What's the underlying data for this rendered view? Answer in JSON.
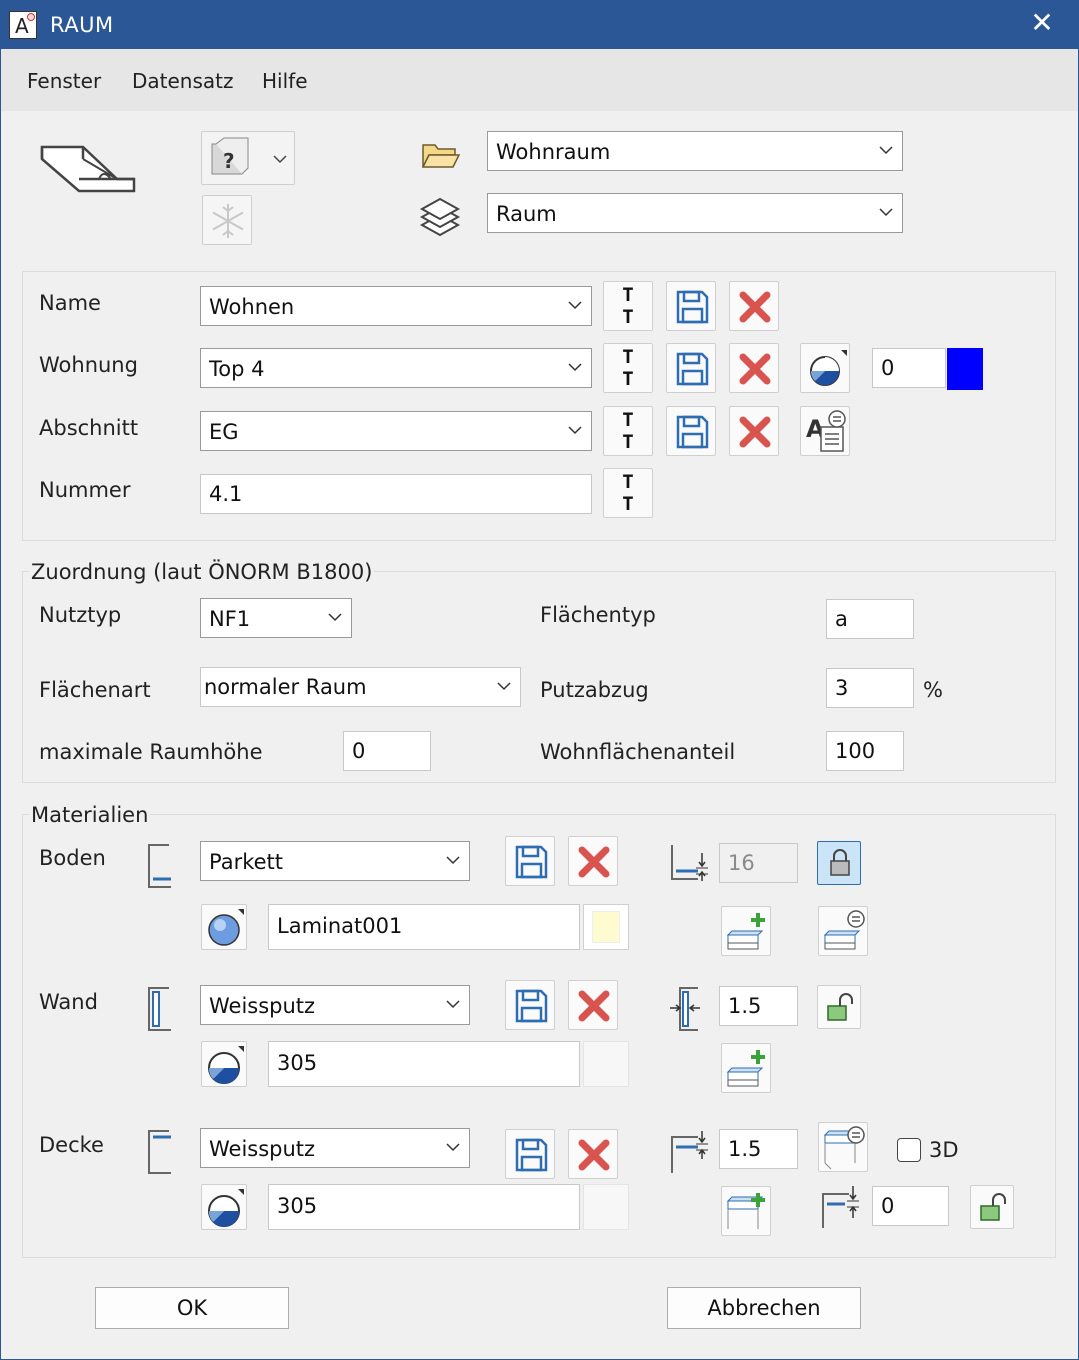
{
  "window": {
    "title": "RAUM",
    "close_symbol": "✕"
  },
  "menu": [
    "Fenster",
    "Datensatz",
    "Hilfe"
  ],
  "top": {
    "folder_combo": "Wohnraum",
    "layer_combo": "Raum",
    "help_glyph": "?"
  },
  "ident": {
    "name_label": "Name",
    "name_value": "Wohnen",
    "wohnung_label": "Wohnung",
    "wohnung_value": "Top 4",
    "wohnung_color_number": "0",
    "wohnung_color": "#0000ff",
    "abschnitt_label": "Abschnitt",
    "abschnitt_value": "EG",
    "nummer_label": "Nummer",
    "nummer_value": "4.1",
    "text_toggle_glyph": "T"
  },
  "zuordnung": {
    "legend": "Zuordnung (laut ÖNORM B1800)",
    "nutztyp_label": "Nutztyp",
    "nutztyp_value": "NF1",
    "flaechentyp_label": "Flächentyp",
    "flaechentyp_value": "a",
    "flaechenart_label": "Flächenart",
    "flaechenart_value": "normaler Raum",
    "putzabzug_label": "Putzabzug",
    "putzabzug_value": "3",
    "putzabzug_unit": "%",
    "raumhoehe_label": "maximale Raumhöhe",
    "raumhoehe_value": "0",
    "wohnflaeche_label": "Wohnflächenanteil",
    "wohnflaeche_value": "100"
  },
  "materialien": {
    "legend": "Materialien",
    "boden": {
      "label": "Boden",
      "material": "Parkett",
      "texture": "Laminat001",
      "thickness": "16"
    },
    "wand": {
      "label": "Wand",
      "material": "Weissputz",
      "texture": "305",
      "thickness": "1.5"
    },
    "decke": {
      "label": "Decke",
      "material": "Weissputz",
      "texture": "305",
      "thickness": "1.5",
      "offset": "0",
      "check_label": "3D"
    }
  },
  "buttons": {
    "ok": "OK",
    "cancel": "Abbrechen"
  },
  "colors": {
    "titlebar": "#2b5797",
    "accent_blue": "#0000ff",
    "delete_red": "#d9534f"
  }
}
